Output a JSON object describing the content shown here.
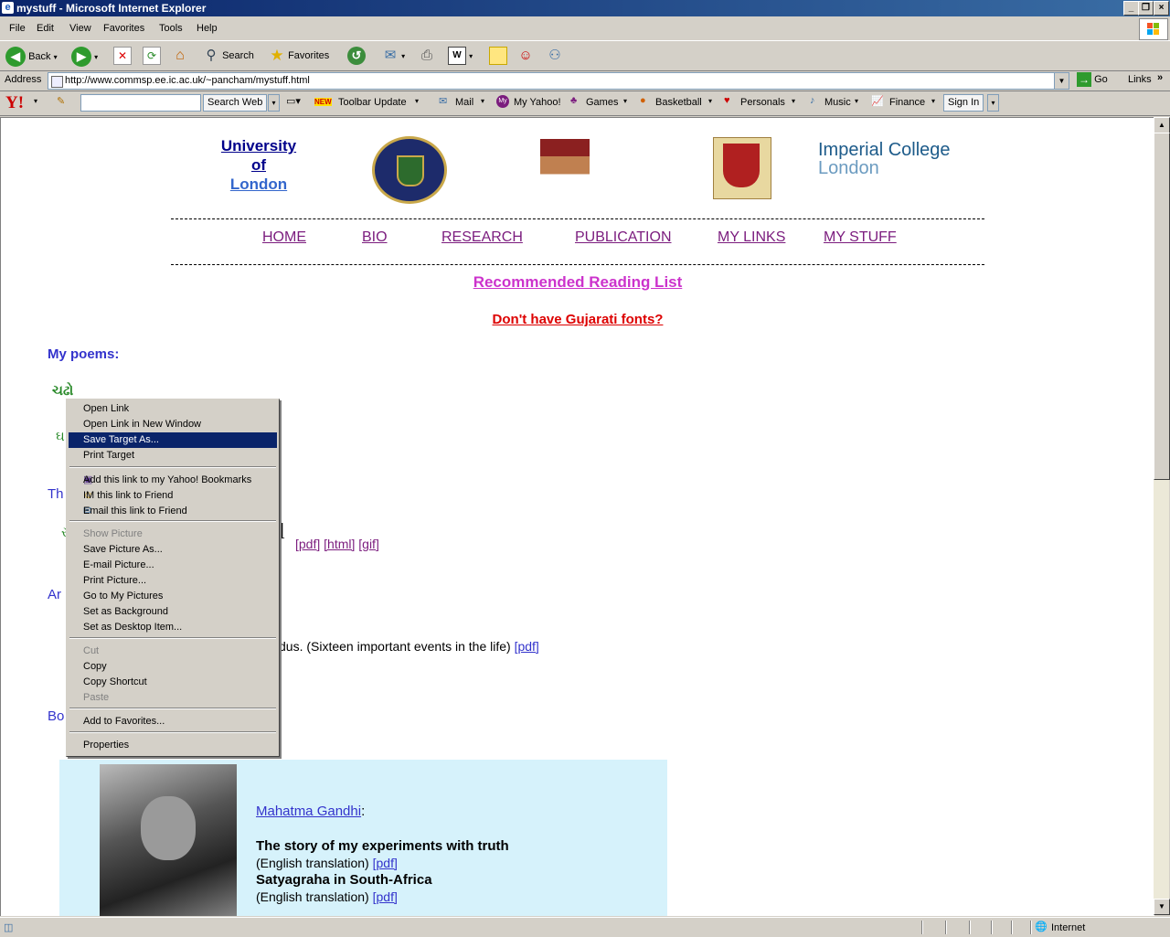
{
  "window": {
    "title": "mystuff - Microsoft Internet Explorer"
  },
  "menu": [
    "File",
    "Edit",
    "View",
    "Favorites",
    "Tools",
    "Help"
  ],
  "toolbar": {
    "back": "Back",
    "search": "Search",
    "favorites": "Favorites"
  },
  "address": {
    "label": "Address",
    "url": "http://www.commsp.ee.ic.ac.uk/~pancham/mystuff.html",
    "go": "Go",
    "links": "Links"
  },
  "yahoo_bar": {
    "search_web": "Search Web",
    "toolbar_update": "Toolbar Update",
    "items": [
      "Mail",
      "My Yahoo!",
      "Games",
      "Basketball",
      "Personals",
      "Music",
      "Finance"
    ],
    "sign_in": "Sign In"
  },
  "page": {
    "uol": [
      "University",
      "of",
      "London"
    ],
    "imperial": [
      "Imperial College",
      "London"
    ],
    "nav": [
      "HOME",
      "BIO",
      "RESEARCH",
      "PUBLICATION",
      "MY LINKS",
      "MY STUFF"
    ],
    "reading_list": "Recommended Reading List",
    "gujarati_fonts": "Don't have Gujarati fonts?",
    "my_poems": "My poems:",
    "poem1": "ચઢો",
    "sec_th": "Th",
    "sec_ar": "Ar",
    "sec_bo": "Bo",
    "links1": [
      "[pdf]",
      "[html]",
      "[gif]"
    ],
    "text_dus": "dus. (Sixteen important  events in the life)",
    "link_pdf": "[pdf]",
    "gandhi": {
      "author": "Mahatma Gandhi",
      "book1": "The story of my experiments with truth",
      "trans1": "(English translation)",
      "book2": "Satyagraha in South-Africa",
      "trans2": "(English translation)",
      "pdf": "[pdf]"
    }
  },
  "context_menu": {
    "items": [
      {
        "label": "Open Link",
        "disabled": false
      },
      {
        "label": "Open Link in New Window",
        "disabled": false
      },
      {
        "label": "Save Target As...",
        "disabled": false,
        "selected": true
      },
      {
        "label": "Print Target",
        "disabled": false
      },
      {
        "label": "Add this link to my Yahoo! Bookmarks",
        "disabled": false
      },
      {
        "label": "IM this link to Friend",
        "disabled": false
      },
      {
        "label": "Email this link to Friend",
        "disabled": false
      },
      {
        "label": "Show Picture",
        "disabled": true
      },
      {
        "label": "Save Picture As...",
        "disabled": false
      },
      {
        "label": "E-mail Picture...",
        "disabled": false
      },
      {
        "label": "Print Picture...",
        "disabled": false
      },
      {
        "label": "Go to My Pictures",
        "disabled": false
      },
      {
        "label": "Set as Background",
        "disabled": false
      },
      {
        "label": "Set as Desktop Item...",
        "disabled": false
      },
      {
        "label": "Cut",
        "disabled": true
      },
      {
        "label": "Copy",
        "disabled": false
      },
      {
        "label": "Copy Shortcut",
        "disabled": false
      },
      {
        "label": "Paste",
        "disabled": true
      },
      {
        "label": "Add to Favorites...",
        "disabled": false
      },
      {
        "label": "Properties",
        "disabled": false
      }
    ]
  },
  "status": {
    "zone": "Internet"
  },
  "colors": {
    "title_bar": "#0a246a",
    "chrome": "#d4d0c8",
    "menu_highlight": "#0a246a",
    "gandhi_box": "#d6f2fb",
    "nav_link": "#7b1c7e",
    "heading": "#3333cc"
  }
}
